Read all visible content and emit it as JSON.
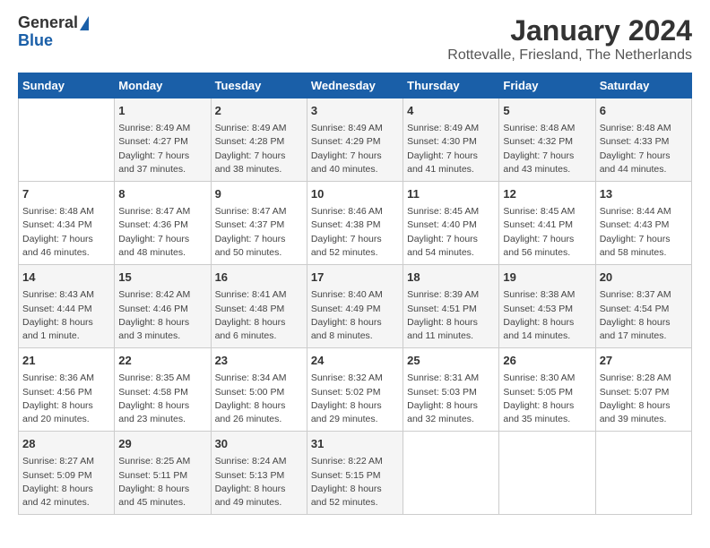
{
  "logo": {
    "general": "General",
    "blue": "Blue"
  },
  "title": "January 2024",
  "location": "Rottevalle, Friesland, The Netherlands",
  "days_of_week": [
    "Sunday",
    "Monday",
    "Tuesday",
    "Wednesday",
    "Thursday",
    "Friday",
    "Saturday"
  ],
  "weeks": [
    [
      {
        "day": "",
        "info": ""
      },
      {
        "day": "1",
        "info": "Sunrise: 8:49 AM\nSunset: 4:27 PM\nDaylight: 7 hours\nand 37 minutes."
      },
      {
        "day": "2",
        "info": "Sunrise: 8:49 AM\nSunset: 4:28 PM\nDaylight: 7 hours\nand 38 minutes."
      },
      {
        "day": "3",
        "info": "Sunrise: 8:49 AM\nSunset: 4:29 PM\nDaylight: 7 hours\nand 40 minutes."
      },
      {
        "day": "4",
        "info": "Sunrise: 8:49 AM\nSunset: 4:30 PM\nDaylight: 7 hours\nand 41 minutes."
      },
      {
        "day": "5",
        "info": "Sunrise: 8:48 AM\nSunset: 4:32 PM\nDaylight: 7 hours\nand 43 minutes."
      },
      {
        "day": "6",
        "info": "Sunrise: 8:48 AM\nSunset: 4:33 PM\nDaylight: 7 hours\nand 44 minutes."
      }
    ],
    [
      {
        "day": "7",
        "info": "Sunrise: 8:48 AM\nSunset: 4:34 PM\nDaylight: 7 hours\nand 46 minutes."
      },
      {
        "day": "8",
        "info": "Sunrise: 8:47 AM\nSunset: 4:36 PM\nDaylight: 7 hours\nand 48 minutes."
      },
      {
        "day": "9",
        "info": "Sunrise: 8:47 AM\nSunset: 4:37 PM\nDaylight: 7 hours\nand 50 minutes."
      },
      {
        "day": "10",
        "info": "Sunrise: 8:46 AM\nSunset: 4:38 PM\nDaylight: 7 hours\nand 52 minutes."
      },
      {
        "day": "11",
        "info": "Sunrise: 8:45 AM\nSunset: 4:40 PM\nDaylight: 7 hours\nand 54 minutes."
      },
      {
        "day": "12",
        "info": "Sunrise: 8:45 AM\nSunset: 4:41 PM\nDaylight: 7 hours\nand 56 minutes."
      },
      {
        "day": "13",
        "info": "Sunrise: 8:44 AM\nSunset: 4:43 PM\nDaylight: 7 hours\nand 58 minutes."
      }
    ],
    [
      {
        "day": "14",
        "info": "Sunrise: 8:43 AM\nSunset: 4:44 PM\nDaylight: 8 hours\nand 1 minute."
      },
      {
        "day": "15",
        "info": "Sunrise: 8:42 AM\nSunset: 4:46 PM\nDaylight: 8 hours\nand 3 minutes."
      },
      {
        "day": "16",
        "info": "Sunrise: 8:41 AM\nSunset: 4:48 PM\nDaylight: 8 hours\nand 6 minutes."
      },
      {
        "day": "17",
        "info": "Sunrise: 8:40 AM\nSunset: 4:49 PM\nDaylight: 8 hours\nand 8 minutes."
      },
      {
        "day": "18",
        "info": "Sunrise: 8:39 AM\nSunset: 4:51 PM\nDaylight: 8 hours\nand 11 minutes."
      },
      {
        "day": "19",
        "info": "Sunrise: 8:38 AM\nSunset: 4:53 PM\nDaylight: 8 hours\nand 14 minutes."
      },
      {
        "day": "20",
        "info": "Sunrise: 8:37 AM\nSunset: 4:54 PM\nDaylight: 8 hours\nand 17 minutes."
      }
    ],
    [
      {
        "day": "21",
        "info": "Sunrise: 8:36 AM\nSunset: 4:56 PM\nDaylight: 8 hours\nand 20 minutes."
      },
      {
        "day": "22",
        "info": "Sunrise: 8:35 AM\nSunset: 4:58 PM\nDaylight: 8 hours\nand 23 minutes."
      },
      {
        "day": "23",
        "info": "Sunrise: 8:34 AM\nSunset: 5:00 PM\nDaylight: 8 hours\nand 26 minutes."
      },
      {
        "day": "24",
        "info": "Sunrise: 8:32 AM\nSunset: 5:02 PM\nDaylight: 8 hours\nand 29 minutes."
      },
      {
        "day": "25",
        "info": "Sunrise: 8:31 AM\nSunset: 5:03 PM\nDaylight: 8 hours\nand 32 minutes."
      },
      {
        "day": "26",
        "info": "Sunrise: 8:30 AM\nSunset: 5:05 PM\nDaylight: 8 hours\nand 35 minutes."
      },
      {
        "day": "27",
        "info": "Sunrise: 8:28 AM\nSunset: 5:07 PM\nDaylight: 8 hours\nand 39 minutes."
      }
    ],
    [
      {
        "day": "28",
        "info": "Sunrise: 8:27 AM\nSunset: 5:09 PM\nDaylight: 8 hours\nand 42 minutes."
      },
      {
        "day": "29",
        "info": "Sunrise: 8:25 AM\nSunset: 5:11 PM\nDaylight: 8 hours\nand 45 minutes."
      },
      {
        "day": "30",
        "info": "Sunrise: 8:24 AM\nSunset: 5:13 PM\nDaylight: 8 hours\nand 49 minutes."
      },
      {
        "day": "31",
        "info": "Sunrise: 8:22 AM\nSunset: 5:15 PM\nDaylight: 8 hours\nand 52 minutes."
      },
      {
        "day": "",
        "info": ""
      },
      {
        "day": "",
        "info": ""
      },
      {
        "day": "",
        "info": ""
      }
    ]
  ]
}
